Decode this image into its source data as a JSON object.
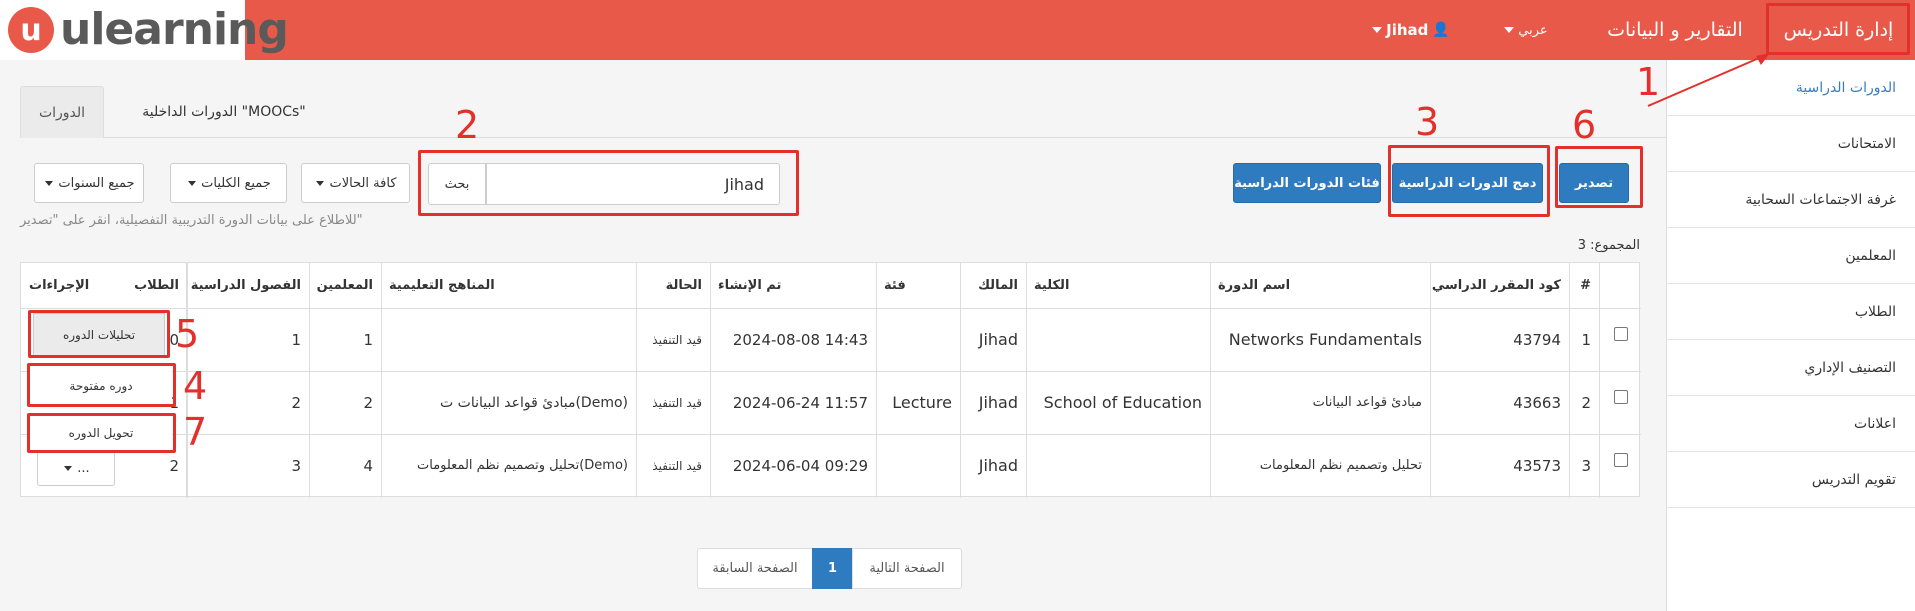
{
  "brand": {
    "logo_text": "ulearning",
    "logo_mark": "u"
  },
  "nav": {
    "user": "Jihad",
    "language": "عربي",
    "reports": "التقارير و البيانات",
    "teaching": "إدارة التدريس"
  },
  "sidebar": {
    "items": [
      {
        "label": "الدورات الدراسية",
        "active": true
      },
      {
        "label": "الامتحانات"
      },
      {
        "label": "غرفة الاجتماعات السحابية"
      },
      {
        "label": "المعلمين"
      },
      {
        "label": "الطلاب"
      },
      {
        "label": "التصنيف الإداري"
      },
      {
        "label": "اعلانات"
      },
      {
        "label": "تقويم التدريس"
      }
    ]
  },
  "tabs": {
    "courses": "الدورات",
    "moocs": "الدورات الداخلية \"MOOCs\""
  },
  "toolbar": {
    "years": "جميع السنوات",
    "colleges": "جميع الكليات",
    "statuses": "كافة الحالات",
    "search_btn": "بحث",
    "search_value": "Jihad",
    "categories": "فئات الدورات الدراسية",
    "merge": "دمج الدورات الدراسية",
    "export": "تصدير"
  },
  "hint": "للاطلاع على بيانات الدورة التدريبية التفصيلية، انقر على \"تصدير\"",
  "total": "المجموع: 3",
  "table": {
    "headers": {
      "num": "#",
      "code": "كود المقرر الدراسي",
      "name": "اسم الدورة",
      "college": "الكلية",
      "owner": "المالك",
      "category": "فئة",
      "created": "تم الإنشاء",
      "status": "الحالة",
      "curricula": "المناهج التعليمية",
      "teachers": "المعلمين",
      "classes": "الفصول الدراسية",
      "students": "الطلاب",
      "actions": "الإجراءات"
    },
    "rows": [
      {
        "num": "1",
        "code": "43794",
        "name": "Networks Fundamentals",
        "college": "",
        "owner": "Jihad",
        "category": "",
        "created": "2024-08-08 14:43",
        "status": "قيد التنفيذ",
        "curricula": "",
        "teachers": "1",
        "classes": "1",
        "students": "0"
      },
      {
        "num": "2",
        "code": "43663",
        "name": "مبادئ قواعد البيانات",
        "college": "School of Education",
        "owner": "Jihad",
        "category": "Lecture",
        "created": "2024-06-24 11:57",
        "status": "قيد التنفيذ",
        "curricula": "مبادئ قواعد البيانات ت(Demo)",
        "teachers": "2",
        "classes": "2",
        "students": "1"
      },
      {
        "num": "3",
        "code": "43573",
        "name": "تحليل وتصميم نظم المعلومات",
        "college": "",
        "owner": "Jihad",
        "category": "",
        "created": "2024-06-04 09:29",
        "status": "قيد التنفيذ",
        "curricula": "تحليل وتصميم نظم المعلومات(Demo)",
        "teachers": "4",
        "classes": "3",
        "students": "2"
      }
    ]
  },
  "actions_menu": {
    "analytics": "تحليلات الدوره",
    "open_course": "دوره مفتوحة",
    "transfer": "تحويل الدوره",
    "more": "..."
  },
  "pager": {
    "next": "الصفحة التالية",
    "current": "1",
    "prev": "الصفحة السابقة"
  },
  "annotations": [
    "1",
    "2",
    "3",
    "4",
    "5",
    "6",
    "7"
  ],
  "colors": {
    "header_bar": "#e8594a",
    "primary": "#2f7bbf",
    "annotation": "#e4302b"
  }
}
